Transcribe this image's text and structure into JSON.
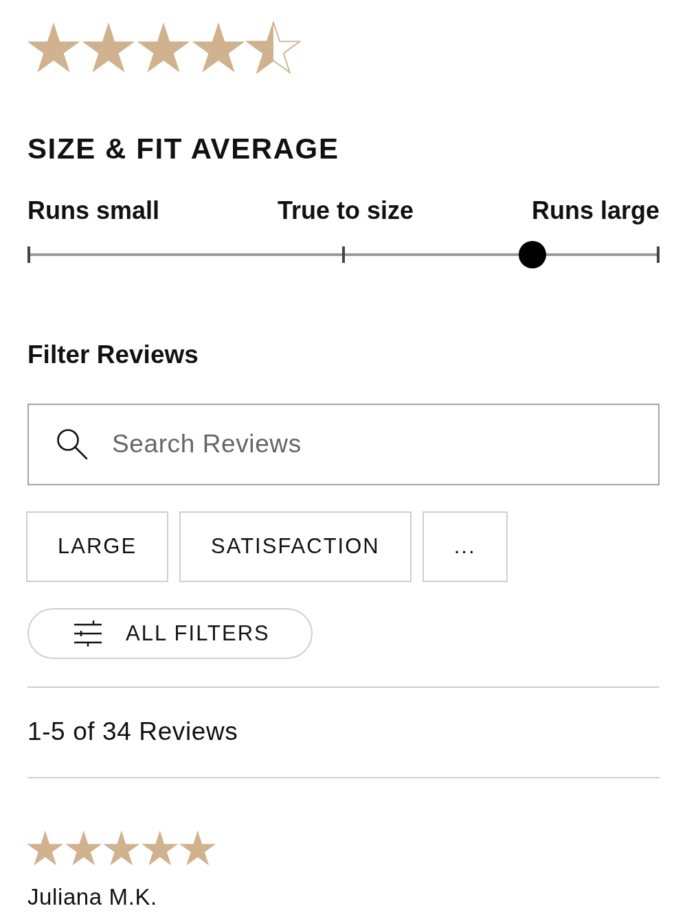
{
  "overall_rating": {
    "stars": 4.5
  },
  "size_fit": {
    "title": "SIZE & FIT AVERAGE",
    "labels": [
      "Runs small",
      "True to size",
      "Runs large"
    ],
    "level": 0.8
  },
  "filter_reviews": {
    "title": "Filter Reviews",
    "search": {
      "placeholder": "Search Reviews"
    },
    "chips": [
      "LARGE",
      "SATISFACTION",
      "..."
    ],
    "all_filters_button": "ALL FILTERS"
  },
  "results_count": "1-5 of 34 Reviews",
  "reviews": [
    {
      "stars": 5,
      "author": "Juliana M.K."
    }
  ]
}
